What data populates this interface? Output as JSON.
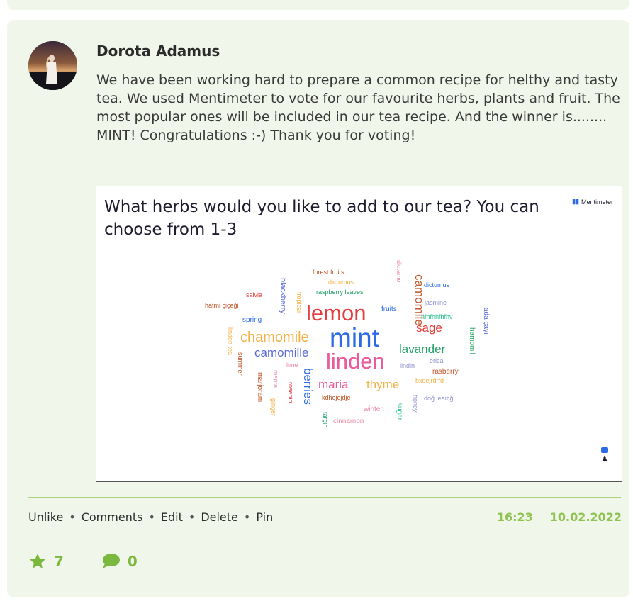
{
  "post": {
    "author": "Dorota Adamus",
    "text": "We have been working hard to prepare a common recipe for helthy and tasty tea. We used Mentimeter to vote for our favourite herbs, plants and fruit. The most popular ones will be included in our tea recipe. And the winner is........ MINT! Congratulations :-) Thank you for voting!",
    "time": "16:23",
    "date": "10.02.2022"
  },
  "slide": {
    "title": "What herbs would you like to add to our tea? You can choose from 1-3",
    "brand": "Mentimeter"
  },
  "wordcloud": [
    {
      "text": "forest fruits",
      "color": "#c0562a",
      "vertical": false
    },
    {
      "text": "dictumus",
      "color": "#f4b043",
      "vertical": false
    },
    {
      "text": "raspberry leaves",
      "color": "#25a169",
      "vertical": false
    },
    {
      "text": "dictamo",
      "color": "#e98aa6",
      "vertical": true
    },
    {
      "text": "dictumus",
      "color": "#2d6be4",
      "vertical": false
    },
    {
      "text": "salvia",
      "color": "#e53d3d",
      "vertical": false
    },
    {
      "text": "blackberry",
      "color": "#5b6bd6",
      "vertical": true
    },
    {
      "text": "hatmi çiçeği",
      "color": "#c0562a",
      "vertical": false
    },
    {
      "text": "tropical",
      "color": "#f4b043",
      "vertical": true
    },
    {
      "text": "lemon",
      "color": "#e53d3d",
      "vertical": false
    },
    {
      "text": "fruits",
      "color": "#2d6be4",
      "vertical": false
    },
    {
      "text": "camomile",
      "color": "#c0562a",
      "vertical": true
    },
    {
      "text": "jasmine",
      "color": "#8f8fd0",
      "vertical": false
    },
    {
      "text": "spring",
      "color": "#2d6be4",
      "vertical": false
    },
    {
      "text": "hfhfhhfhfhv",
      "color": "#25c28a",
      "vertical": false
    },
    {
      "text": "ada çayı",
      "color": "#5b6bd6",
      "vertical": true
    },
    {
      "text": "chamomile",
      "color": "#f4b043",
      "vertical": false
    },
    {
      "text": "mint",
      "color": "#2d6be4",
      "vertical": false
    },
    {
      "text": "sage",
      "color": "#e53d3d",
      "vertical": false
    },
    {
      "text": "hamomil",
      "color": "#25a169",
      "vertical": true
    },
    {
      "text": "linden tea",
      "color": "#f4b043",
      "vertical": true
    },
    {
      "text": "camomille",
      "color": "#5b6bd6",
      "vertical": false
    },
    {
      "text": "lavander",
      "color": "#25a169",
      "vertical": false
    },
    {
      "text": "summer",
      "color": "#c0562a",
      "vertical": true
    },
    {
      "text": "linden",
      "color": "#e95b9c",
      "vertical": false
    },
    {
      "text": "erica",
      "color": "#8f8fd0",
      "vertical": false
    },
    {
      "text": "lime",
      "color": "#e98aa6",
      "vertical": false
    },
    {
      "text": "lindin",
      "color": "#8f8fd0",
      "vertical": false
    },
    {
      "text": "marjoram",
      "color": "#c0562a",
      "vertical": true
    },
    {
      "text": "menta",
      "color": "#e98aa6",
      "vertical": true
    },
    {
      "text": "berries",
      "color": "#2d6be4",
      "vertical": true
    },
    {
      "text": "rasberry",
      "color": "#c0562a",
      "vertical": false
    },
    {
      "text": "rosehip",
      "color": "#e53d3d",
      "vertical": true
    },
    {
      "text": "maria",
      "color": "#e95b9c",
      "vertical": false
    },
    {
      "text": "thyme",
      "color": "#f4b043",
      "vertical": false
    },
    {
      "text": "bxdejrdrfd",
      "color": "#f4b043",
      "vertical": false
    },
    {
      "text": "ginger",
      "color": "#f4b043",
      "vertical": true
    },
    {
      "text": "kdhejejdje",
      "color": "#c0562a",
      "vertical": false
    },
    {
      "text": "honey",
      "color": "#8f8fd0",
      "vertical": true
    },
    {
      "text": "doğ leeıcği",
      "color": "#8f8fd0",
      "vertical": false
    },
    {
      "text": "sugar",
      "color": "#25c28a",
      "vertical": true
    },
    {
      "text": "winter",
      "color": "#e98aa6",
      "vertical": false
    },
    {
      "text": "tarçın",
      "color": "#25a169",
      "vertical": true
    },
    {
      "text": "cinnamon",
      "color": "#e98aa6",
      "vertical": false
    }
  ],
  "actions": {
    "unlike": "Unlike",
    "comments": "Comments",
    "edit": "Edit",
    "delete": "Delete",
    "pin": "Pin",
    "separator": "•"
  },
  "stats": {
    "stars": "7",
    "comments": "0"
  },
  "icons": {
    "star": "star-icon",
    "comment": "comment-bubble-icon"
  },
  "colors": {
    "card_bg": "#f1f6ea",
    "accent_green": "#8ec351",
    "divider": "#a9d27e"
  }
}
